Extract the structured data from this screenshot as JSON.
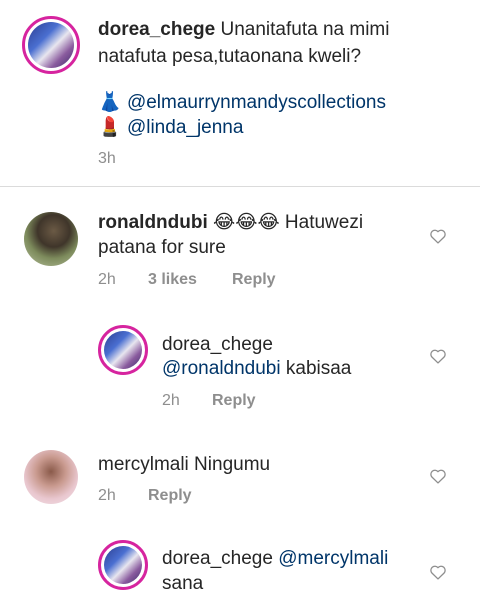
{
  "caption": {
    "username": "dorea_chege",
    "text": "Unanitafuta na mimi natafuta pesa,tutaonana kweli?",
    "line1_user": "dorea_chege",
    "line1_rest": " Unanitafuta na mimi",
    "line2": "natafuta pesa,tutaonana kweli?",
    "credits": [
      {
        "emoji": "👗",
        "handle": "@elmaurrynmandyscollections"
      },
      {
        "emoji": "💄",
        "handle": "@linda_jenna"
      }
    ],
    "time": "3h"
  },
  "comments": [
    {
      "username": "ronaldndubi",
      "text_line1": "😂😂😂 Hatuwezi",
      "text_line2": "patana for sure",
      "time": "2h",
      "likes": "3 likes",
      "reply": "Reply"
    },
    {
      "username": "dorea_chege",
      "mention": "@ronaldndubi",
      "text": " kabisaa",
      "time": "2h",
      "reply": "Reply"
    },
    {
      "username": "mercylmali",
      "text": " Ningumu",
      "time": "2h",
      "reply": "Reply"
    },
    {
      "username": "dorea_chege",
      "mention": "@mercylmali",
      "text_partial": "sana"
    }
  ],
  "colors": {
    "text": "#262626",
    "meta": "#8e8e8e",
    "mention": "#003569",
    "divider": "#dbdbdb",
    "story_ring": "#d6249f"
  },
  "icons": {
    "like": "heart-outline-icon"
  }
}
